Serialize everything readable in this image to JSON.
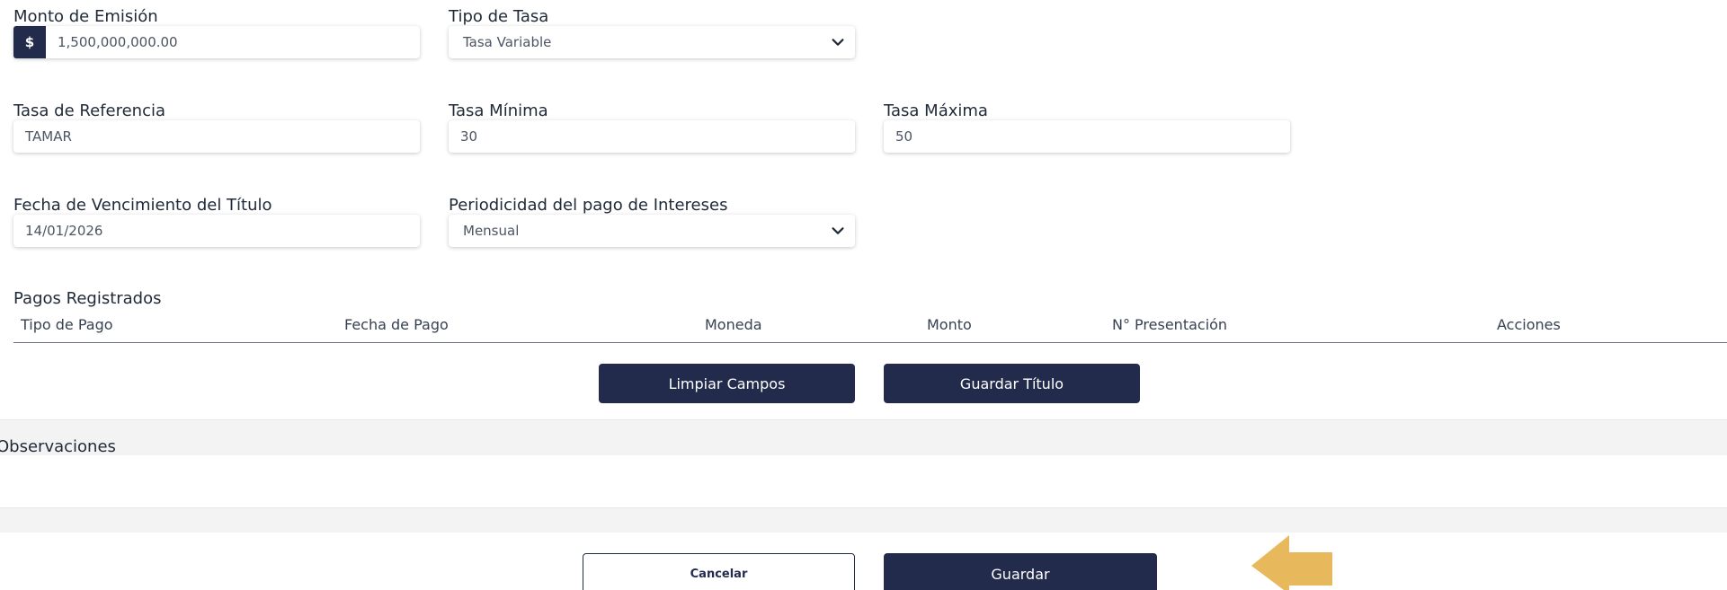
{
  "form": {
    "monto_emision": {
      "label": "Monto de Emisión",
      "prefix": "$",
      "value": "1,500,000,000.00"
    },
    "tipo_tasa": {
      "label": "Tipo de Tasa",
      "value": "Tasa Variable"
    },
    "tasa_referencia": {
      "label": "Tasa de Referencia",
      "value": "TAMAR"
    },
    "tasa_minima": {
      "label": "Tasa Mínima",
      "value": "30"
    },
    "tasa_maxima": {
      "label": "Tasa Máxima",
      "value": "50"
    },
    "fecha_vencimiento": {
      "label": "Fecha de Vencimiento del Título",
      "value": "14/01/2026"
    },
    "periodicidad": {
      "label": "Periodicidad del pago de Intereses",
      "value": "Mensual"
    }
  },
  "pagos": {
    "title": "Pagos Registrados",
    "columns": [
      "Tipo de Pago",
      "Fecha de Pago",
      "Moneda",
      "Monto",
      "N° Presentación",
      "Acciones"
    ]
  },
  "actions": {
    "limpiar_label": "Limpiar Campos",
    "guardar_titulo_label": "Guardar Título"
  },
  "observaciones": {
    "title": "Observaciones"
  },
  "footer": {
    "cancelar_label": "Cancelar",
    "guardar_label": "Guardar"
  },
  "icons": {
    "select_arrow": "chevron-down-icon",
    "hint_arrow": "arrow-left-icon"
  },
  "colors": {
    "primary": "#232b4d",
    "hint_arrow": "#e8b85c",
    "band": "#f3f3f3"
  }
}
